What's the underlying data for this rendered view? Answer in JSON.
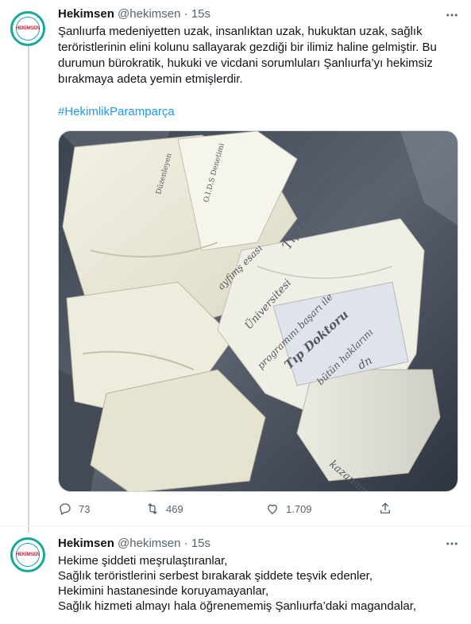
{
  "tweet1": {
    "author": {
      "name": "Hekimsen",
      "handle": "@hekimsen",
      "separator": "·",
      "time": "15s",
      "avatar_text": "HEKİMSEN",
      "avatar_year": "2019"
    },
    "text": "Şanlıurfa medeniyetten uzak, insanlıktan uzak, hukuktan uzak, sağlık teröristlerinin elini kolunu sallayarak gezdiği bir ilimiz haline gelmiştir. Bu durumun bürokratik, hukuki ve vicdani sorumluları Şanlıurfa’yı hekimsiz bırakmaya adeta yemin etmişlerdir.",
    "hashtag": "#HekimlikParamparça",
    "media": {
      "paper_texts": [
        "Düzenleyen",
        "O.I.D.S Denetimi",
        "Tıp Fakültesi",
        "ayfimş esası",
        "... Üniversitesi",
        "programını başarı ile",
        "Tıp Doktoru",
        "... bütün haklarını",
        "... kazanmıştır",
        "... dn"
      ]
    },
    "actions": {
      "replies": "73",
      "retweets": "469",
      "likes": "1.709"
    }
  },
  "tweet2": {
    "author": {
      "name": "Hekimsen",
      "handle": "@hekimsen",
      "separator": "·",
      "time": "15s",
      "avatar_text": "HEKİMSEN",
      "avatar_year": "2019"
    },
    "lines": [
      "Hekime şiddeti meşrulaştıranlar,",
      "Sağlık teröristlerini serbest bırakarak şiddete teşvik edenler,",
      "Hekimini hastanesinde koruyamayanlar,",
      "Sağlık hizmeti almayı hala öğrenememiş Şanlıurfa’daki magandalar,"
    ]
  },
  "colors": {
    "accent": "#1d9bf0",
    "secondary_text": "#536471",
    "brand_teal": "#1aa79b",
    "brand_red": "#c81e3a"
  },
  "icons": [
    "more-icon",
    "reply-icon",
    "retweet-icon",
    "like-icon",
    "share-icon"
  ]
}
